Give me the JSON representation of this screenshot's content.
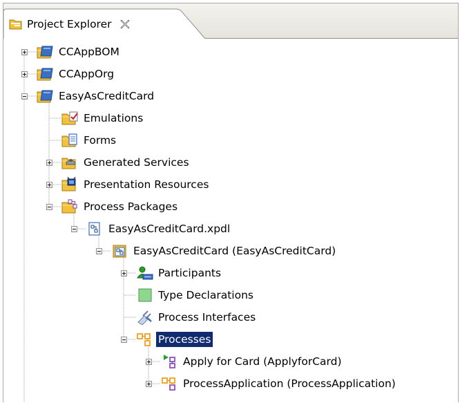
{
  "view": {
    "title": "Project Explorer",
    "icon": "project-explorer-folder-icon",
    "close_icon": "close-x-icon"
  },
  "tree": [
    {
      "label": "CCAppBOM",
      "state": "collapsed",
      "icon": "project-folder-icon"
    },
    {
      "label": "CCAppOrg",
      "state": "collapsed",
      "icon": "project-folder-icon"
    },
    {
      "label": "EasyAsCreditCard",
      "state": "expanded",
      "icon": "project-folder-icon"
    },
    {
      "label": "Emulations",
      "state": "leaf",
      "icon": "emulations-folder-icon"
    },
    {
      "label": "Forms",
      "state": "leaf",
      "icon": "forms-folder-icon"
    },
    {
      "label": "Generated Services",
      "state": "collapsed",
      "icon": "services-folder-icon"
    },
    {
      "label": "Presentation Resources",
      "state": "collapsed",
      "icon": "presentation-folder-icon"
    },
    {
      "label": "Process Packages",
      "state": "expanded",
      "icon": "process-packages-folder-icon"
    },
    {
      "label": "EasyAsCreditCard.xpdl",
      "state": "expanded",
      "icon": "xpdl-file-icon"
    },
    {
      "label": "EasyAsCreditCard (EasyAsCreditCard)",
      "state": "expanded",
      "icon": "package-icon"
    },
    {
      "label": "Participants",
      "state": "collapsed",
      "icon": "participants-icon"
    },
    {
      "label": "Type Declarations",
      "state": "leaf",
      "icon": "type-declarations-icon"
    },
    {
      "label": "Process Interfaces",
      "state": "leaf",
      "icon": "process-interfaces-icon"
    },
    {
      "label": "Processes",
      "state": "expanded",
      "selected": true,
      "icon": "processes-icon"
    },
    {
      "label": "Apply for Card (ApplyforCard)",
      "state": "collapsed",
      "icon": "start-process-icon"
    },
    {
      "label": "ProcessApplication (ProcessApplication)",
      "state": "collapsed",
      "icon": "process-icon"
    }
  ],
  "colors": {
    "selection": "#102b6f",
    "folder": "#f2c23d",
    "project_blue": "#3a6fc4",
    "process_orange": "#f0a020",
    "process_purple": "#8e4fc0"
  }
}
